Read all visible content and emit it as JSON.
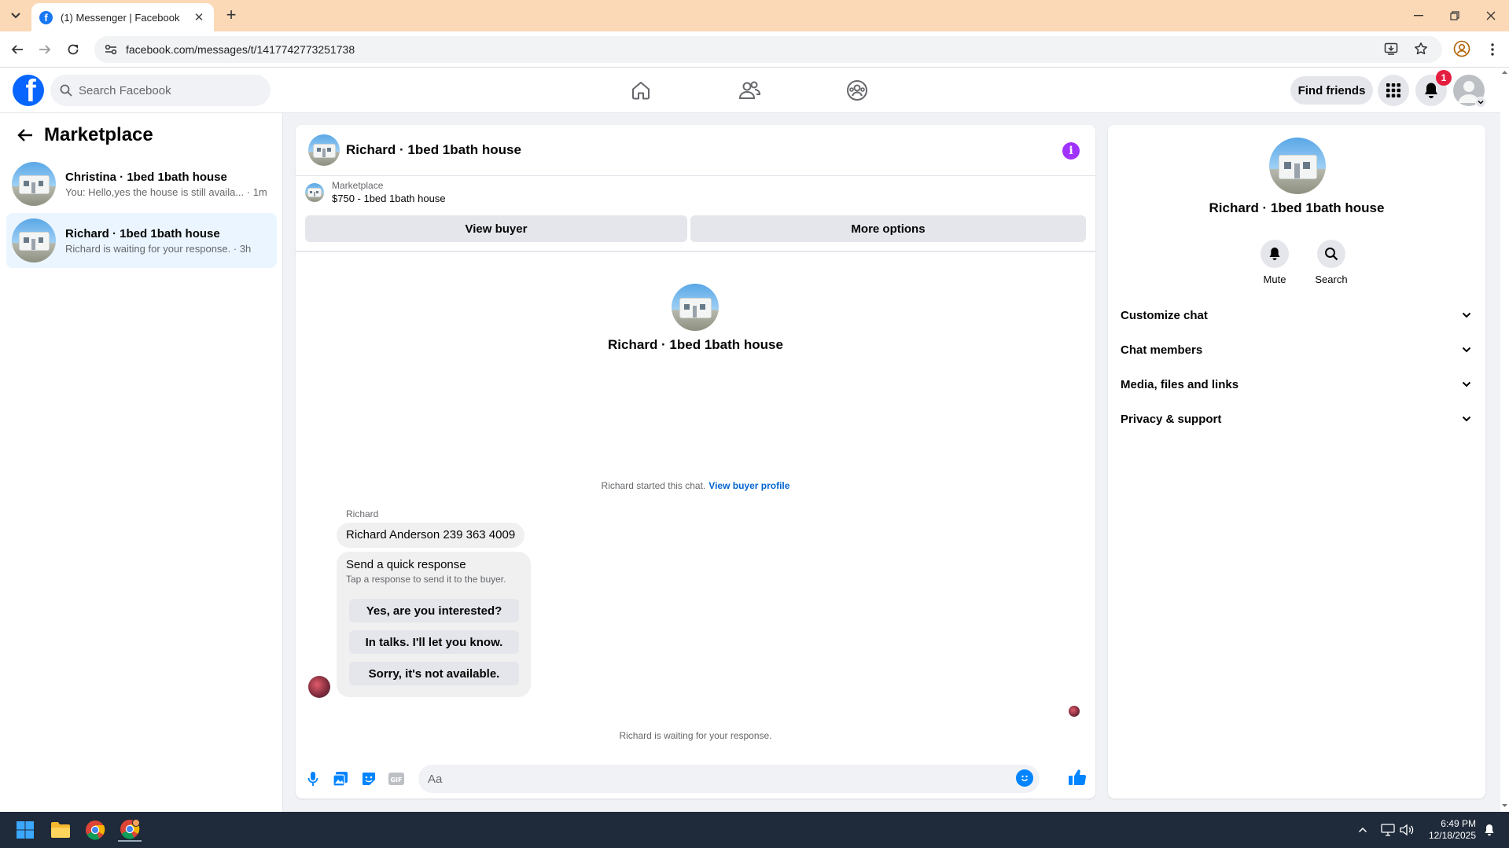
{
  "browser": {
    "tab_title": "(1) Messenger | Facebook",
    "tab_favicon": "f",
    "url": "facebook.com/messages/t/1417742773251738",
    "icons": [
      "tab-list-icon",
      "new-tab-icon",
      "minimize-icon",
      "maximize-icon",
      "close-icon",
      "back-icon",
      "forward-icon",
      "reload-icon",
      "site-settings-icon",
      "install-app-icon",
      "bookmark-star-icon",
      "profile-icon",
      "kebab-menu-icon"
    ]
  },
  "header": {
    "logo": "f",
    "search_placeholder": "Search Facebook",
    "nav": [
      "home-icon",
      "friends-icon",
      "groups-icon"
    ],
    "find_friends": "Find friends",
    "notification_count": "1",
    "colors": {
      "brand": "#0866ff",
      "badge": "#e41e3f"
    }
  },
  "left": {
    "title": "Marketplace",
    "conversations": [
      {
        "name": "Christina · 1bed 1bath house",
        "preview": "You: Hello,yes the house is still availa... · 1m",
        "active": false
      },
      {
        "name": "Richard · 1bed 1bath house",
        "preview": "Richard is waiting for your response. · 3h",
        "active": true
      }
    ]
  },
  "chat": {
    "title": "Richard · 1bed 1bath house",
    "listing": {
      "label": "Marketplace",
      "detail": "$750 - 1bed 1bath house"
    },
    "view_buyer": "View buyer",
    "more_options": "More options",
    "intro_name": "Richard · 1bed 1bath house",
    "started_text": "Richard started this chat.",
    "started_link": "View buyer profile",
    "sender": "Richard",
    "message": "Richard Anderson 239 363 4009",
    "quick": {
      "title": "Send a quick response",
      "subtitle": "Tap a response to send it to the buyer.",
      "options": [
        "Yes, are you interested?",
        "In talks. I'll let you know.",
        "Sorry, it's not available."
      ]
    },
    "waiting": "Richard is waiting for your response.",
    "input_placeholder": "Aa",
    "colors": {
      "accent": "#0084ff",
      "info": "#a033ff"
    }
  },
  "right": {
    "name": "Richard · 1bed 1bath house",
    "actions": [
      "Mute",
      "Search"
    ],
    "sections": [
      "Customize chat",
      "Chat members",
      "Media, files and links",
      "Privacy & support"
    ]
  },
  "taskbar": {
    "time": "6:49 PM",
    "date": "12/18/2025",
    "icons": [
      "windows-start-icon",
      "file-explorer-icon",
      "chrome-icon",
      "chrome-profile-icon",
      "tray-chevron-icon",
      "network-icon",
      "volume-icon",
      "notifications-bell-icon"
    ]
  }
}
